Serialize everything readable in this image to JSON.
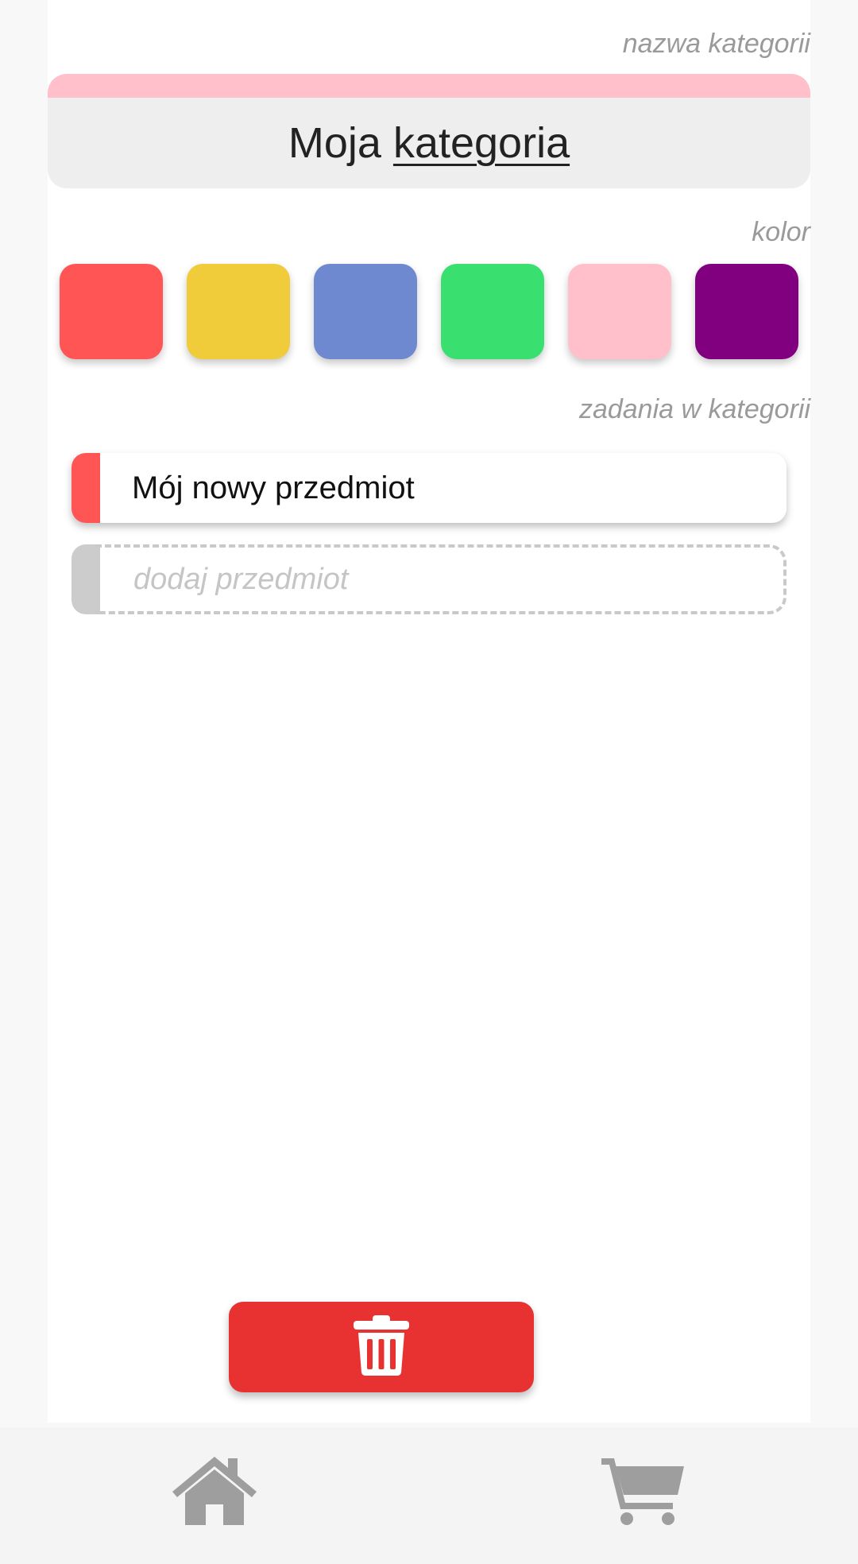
{
  "labels": {
    "category_name": "nazwa kategorii",
    "color": "kolor",
    "tasks": "zadania w kategorii"
  },
  "category": {
    "name_prefix": "Moja",
    "name_underlined": "kategoria",
    "accent_color": "#ffc0cb"
  },
  "colors": [
    "#ff5555",
    "#f0cb3a",
    "#6f89d0",
    "#39e070",
    "#ffc0cb",
    "#800080"
  ],
  "tasks": [
    {
      "name": "Mój nowy przedmiot",
      "color": "#ff5555"
    }
  ],
  "add_task": {
    "placeholder": "dodaj przedmiot"
  },
  "icons": {
    "delete": "trash-icon",
    "home": "home-icon",
    "cart": "cart-icon"
  },
  "theme": {
    "delete_button": "#e83232",
    "nav_icon": "#9e9e9e"
  }
}
